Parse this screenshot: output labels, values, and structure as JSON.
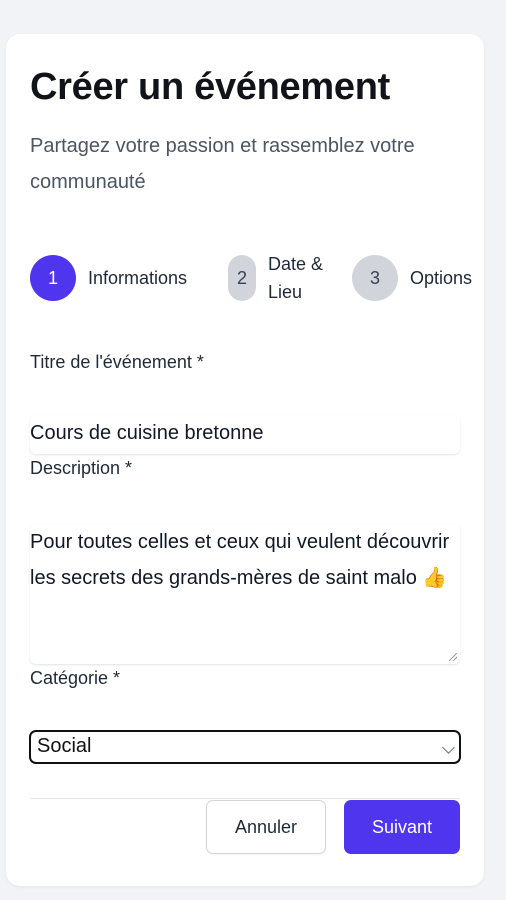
{
  "form": {
    "title": "Créer un événement",
    "subtitle": "Partagez votre passion et rassemblez votre communauté"
  },
  "steps": [
    {
      "number": "1",
      "label": "Informations",
      "state": "active"
    },
    {
      "number": "2",
      "label": "Date & Lieu",
      "state": "inactive"
    },
    {
      "number": "3",
      "label": "Options",
      "state": "inactive"
    }
  ],
  "fields": {
    "title": {
      "label": "Titre de l'événement *",
      "value": "Cours de cuisine bretonne"
    },
    "description": {
      "label": "Description *",
      "value": "Pour toutes celles et ceux qui veulent découvrir les secrets des grands-mères de saint malo 👍"
    },
    "category": {
      "label": "Catégorie *",
      "value": "Social"
    }
  },
  "actions": {
    "cancel_label": "Annuler",
    "next_label": "Suivant"
  },
  "colors": {
    "accent": "#4f35ee",
    "inactive_step": "#d1d5db"
  }
}
